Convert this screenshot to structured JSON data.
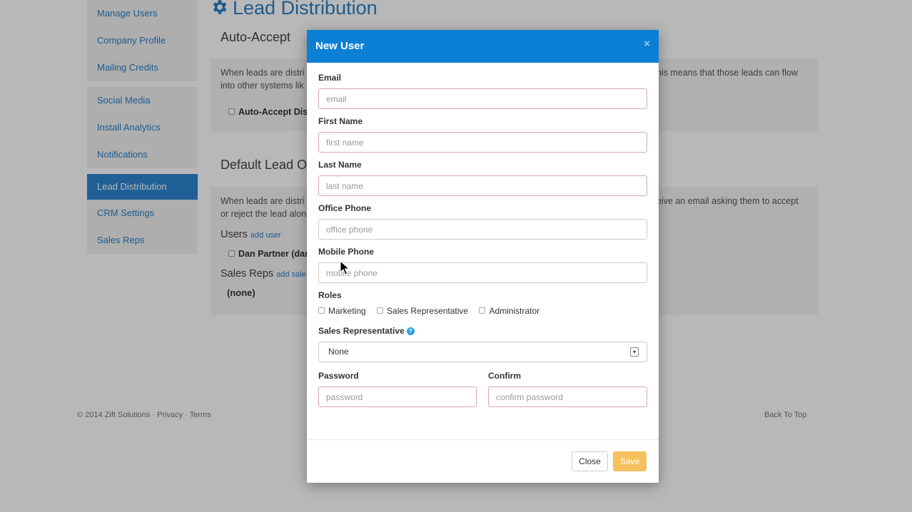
{
  "sidebar": {
    "groups": [
      [
        "Manage Users",
        "Company Profile",
        "Mailing Credits"
      ],
      [
        "Social Media",
        "Install Analytics",
        "Notifications"
      ],
      [
        "Lead Distribution",
        "CRM Settings",
        "Sales Reps"
      ]
    ],
    "active": "Lead Distribution"
  },
  "main": {
    "title": "Lead Distribution",
    "auto_accept": {
      "heading": "Auto-Accept",
      "text_left": "When leads are distri",
      "text_right": "his means that those leads can flow",
      "text_line2": "into other systems lik",
      "checkbox_label": "Auto-Accept Dis"
    },
    "default_lead": {
      "heading": "Default Lead O",
      "text_left": "When leads are distri",
      "text_right": "eive an email asking them to accept",
      "text_line2": "or reject the lead alon",
      "users_heading": "Users",
      "add_user_link": "add user",
      "user_item": "Dan Partner (dan",
      "sales_reps_heading": "Sales Reps",
      "add_sales_link": "add sale",
      "none_label": "(none)"
    }
  },
  "footer": {
    "copyright": "© 2014 Zift Solutions",
    "privacy": "Privacy",
    "terms": "Terms",
    "separator": "·",
    "back_to_top": "Back To Top"
  },
  "modal": {
    "title": "New User",
    "close_x": "×",
    "fields": {
      "email": {
        "label": "Email",
        "placeholder": "email"
      },
      "first_name": {
        "label": "First Name",
        "placeholder": "first name"
      },
      "last_name": {
        "label": "Last Name",
        "placeholder": "last name"
      },
      "office_phone": {
        "label": "Office Phone",
        "placeholder": "office phone"
      },
      "mobile_phone": {
        "label": "Mobile Phone",
        "placeholder": "mobile phone"
      },
      "password": {
        "label": "Password",
        "placeholder": "password"
      },
      "confirm": {
        "label": "Confirm",
        "placeholder": "confirm password"
      }
    },
    "roles": {
      "label": "Roles",
      "options": [
        "Marketing",
        "Sales Representative",
        "Administrator"
      ]
    },
    "sales_rep": {
      "label": "Sales Representative",
      "help_icon": "?",
      "selected": "None",
      "arrow": "▾"
    },
    "buttons": {
      "close": "Close",
      "save": "Save"
    }
  },
  "colors": {
    "header_blue": "#0b7fd4",
    "link_blue": "#2a7fc4",
    "save_orange": "#f6c05c"
  }
}
